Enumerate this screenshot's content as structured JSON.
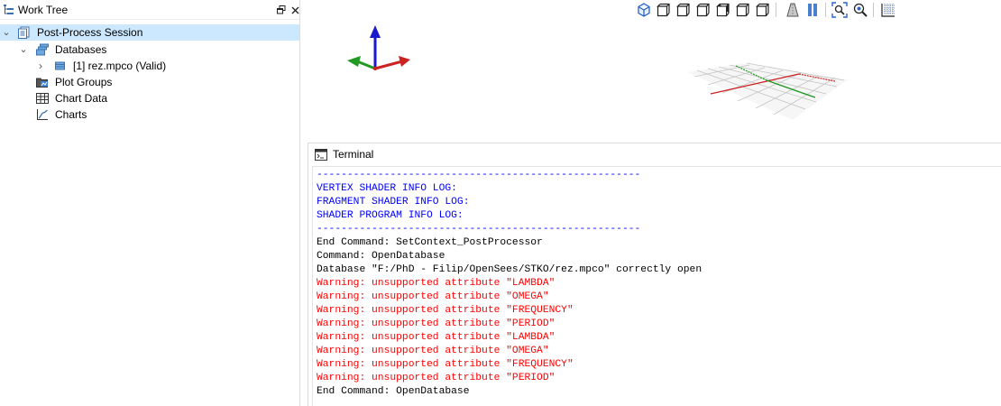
{
  "worktree": {
    "title": "Work Tree",
    "items": [
      {
        "label": "Post-Process Session",
        "icon": "session-icon",
        "selected": true,
        "expanded": true
      },
      {
        "label": "Databases",
        "icon": "databases-icon",
        "expanded": true
      },
      {
        "label": "[1] rez.mpco (Valid)",
        "icon": "database-icon",
        "expanded": false
      },
      {
        "label": "Plot Groups",
        "icon": "plot-groups-icon"
      },
      {
        "label": "Chart Data",
        "icon": "chart-data-icon"
      },
      {
        "label": "Charts",
        "icon": "charts-icon"
      }
    ]
  },
  "toolbar": {
    "buttons": [
      "view-iso-icon",
      "view-front-icon",
      "view-back-icon",
      "view-left-icon",
      "view-right-icon",
      "view-top-icon",
      "view-bottom-icon",
      "perspective-icon",
      "orthographic-icon",
      "zoom-fit-icon",
      "zoom-icon",
      "grid-icon"
    ]
  },
  "terminal": {
    "title": "Terminal",
    "lines": [
      {
        "text": "-----------------------------------------------------",
        "color": "#0000ff"
      },
      {
        "text": "VERTEX SHADER INFO LOG:",
        "color": "#0000ff"
      },
      {
        "text": "FRAGMENT SHADER INFO LOG:",
        "color": "#0000ff"
      },
      {
        "text": "SHADER PROGRAM INFO LOG:",
        "color": "#0000ff"
      },
      {
        "text": "-----------------------------------------------------",
        "color": "#0000ff"
      },
      {
        "text": "End Command: SetContext_PostProcessor",
        "color": "#000000"
      },
      {
        "text": "Command: OpenDatabase",
        "color": "#000000"
      },
      {
        "text": "Database \"F:/PhD - Filip/OpenSees/STKO/rez.mpco\" correctly open",
        "color": "#000000"
      },
      {
        "text": "Warning: unsupported attribute \"LAMBDA\"",
        "color": "#ff0000"
      },
      {
        "text": "Warning: unsupported attribute \"OMEGA\"",
        "color": "#ff0000"
      },
      {
        "text": "Warning: unsupported attribute \"FREQUENCY\"",
        "color": "#ff0000"
      },
      {
        "text": "Warning: unsupported attribute \"PERIOD\"",
        "color": "#ff0000"
      },
      {
        "text": "Warning: unsupported attribute \"LAMBDA\"",
        "color": "#ff0000"
      },
      {
        "text": "Warning: unsupported attribute \"OMEGA\"",
        "color": "#ff0000"
      },
      {
        "text": "Warning: unsupported attribute \"FREQUENCY\"",
        "color": "#ff0000"
      },
      {
        "text": "Warning: unsupported attribute \"PERIOD\"",
        "color": "#ff0000"
      },
      {
        "text": "End Command: OpenDatabase",
        "color": "#000000"
      }
    ]
  },
  "colors": {
    "selection": "#cce8ff",
    "log_info": "#0000ff",
    "log_warning": "#ff0000",
    "axis_x": "#cc2222",
    "axis_y": "#229922",
    "axis_z": "#1a1acc"
  }
}
